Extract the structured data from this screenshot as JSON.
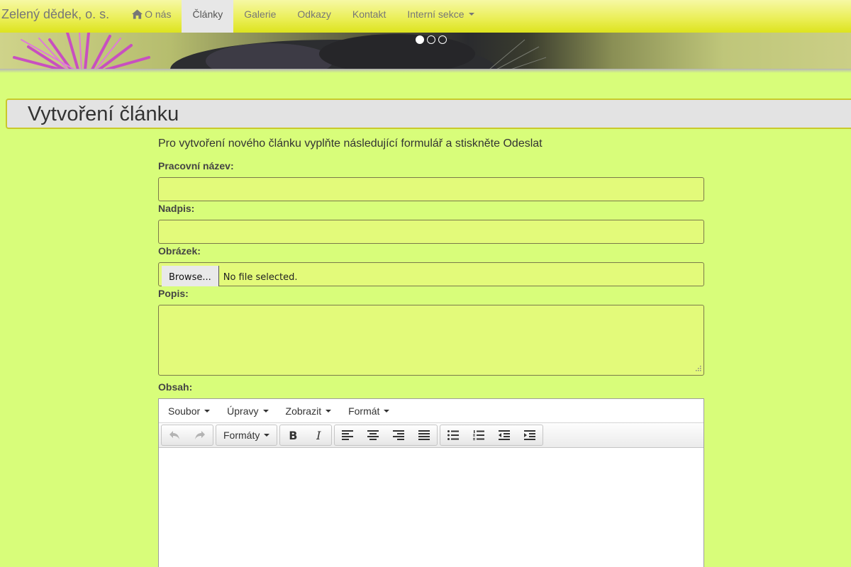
{
  "navbar": {
    "brand": "Zelený dědek, o. s.",
    "items": [
      {
        "label": "O nás",
        "icon": "home-icon"
      },
      {
        "label": "Články",
        "active": true
      },
      {
        "label": "Galerie"
      },
      {
        "label": "Odkazy"
      },
      {
        "label": "Kontakt"
      },
      {
        "label": "Interní sekce",
        "dropdown": true
      }
    ]
  },
  "carousel": {
    "slides": 3,
    "active_index": 0
  },
  "page": {
    "title": "Vytvoření článku"
  },
  "form": {
    "intro": "Pro vytvoření nového článku vyplňte následující formulář a stiskněte Odeslat",
    "fields": {
      "working_name_label": "Pracovní název:",
      "heading_label": "Nadpis:",
      "image_label": "Obrázek:",
      "browse_label": "Browse...",
      "file_status": "No file selected.",
      "description_label": "Popis:",
      "content_label": "Obsah:"
    }
  },
  "editor": {
    "menu": [
      "Soubor",
      "Úpravy",
      "Zobrazit",
      "Formát"
    ],
    "formats_label": "Formáty",
    "toolbar_icons": [
      "undo-icon",
      "redo-icon",
      "bold-icon",
      "italic-icon",
      "align-left-icon",
      "align-center-icon",
      "align-right-icon",
      "align-justify-icon",
      "bullet-list-icon",
      "numbered-list-icon",
      "outdent-icon",
      "indent-icon"
    ],
    "bold_glyph": "B",
    "italic_glyph": "I"
  },
  "colors": {
    "background": "#d8fd7a",
    "navbar_top": "#f6f8a4",
    "navbar_bottom": "#dde31e",
    "input_bg": "#e3fa7a",
    "header_bg": "#e3e3e3"
  }
}
